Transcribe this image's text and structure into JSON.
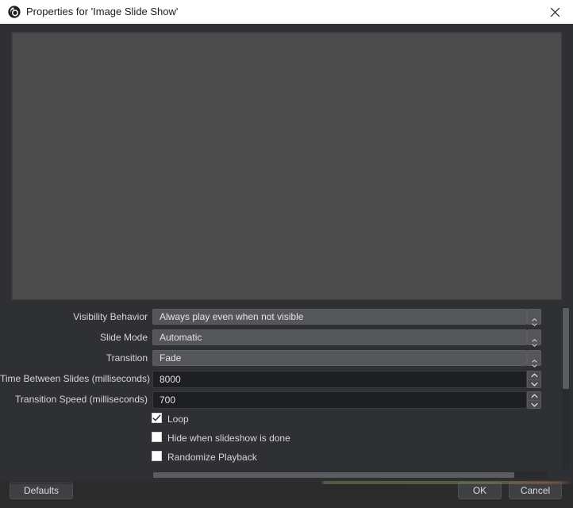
{
  "titlebar": {
    "icon": "obs-logo-icon",
    "title": "Properties for 'Image Slide Show'",
    "close_label": "close-icon"
  },
  "preview": {
    "name": "source-preview-area"
  },
  "form": {
    "combo_rows": [
      {
        "label": "Visibility Behavior",
        "value": "Always play even when not visible",
        "name": "visibility-behavior"
      },
      {
        "label": "Slide Mode",
        "value": "Automatic",
        "name": "slide-mode"
      },
      {
        "label": "Transition",
        "value": "Fade",
        "name": "transition"
      }
    ],
    "spin_rows": [
      {
        "label": "Time Between Slides (milliseconds)",
        "value": "8000",
        "name": "time-between-slides"
      },
      {
        "label": "Transition Speed (milliseconds)",
        "value": "700",
        "name": "transition-speed"
      }
    ],
    "checkboxes": [
      {
        "label": "Loop",
        "checked": true,
        "name": "loop"
      },
      {
        "label": "Hide when slideshow is done",
        "checked": false,
        "name": "hide-when-done"
      },
      {
        "label": "Randomize Playback",
        "checked": false,
        "name": "randomize-playback"
      }
    ]
  },
  "footer": {
    "defaults_label": "Defaults",
    "ok_label": "OK",
    "cancel_label": "Cancel"
  },
  "colors": {
    "dialog_bg": "#2f3033",
    "titlebar_bg": "#ffffff",
    "preview_bg": "#4b4b4b",
    "combo_bg": "#55565a",
    "spin_bg": "#1e1f22",
    "button_bg": "#3f4043",
    "text": "#d6d6d6",
    "scrollbar_thumb": "#5b5c60"
  }
}
